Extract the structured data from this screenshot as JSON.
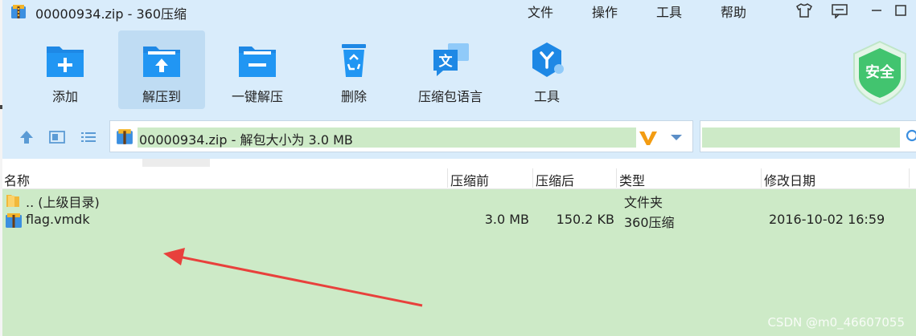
{
  "window": {
    "title": "00000934.zip - 360压缩"
  },
  "menu": [
    "文件",
    "操作",
    "工具",
    "帮助"
  ],
  "toolbar": {
    "items": [
      {
        "label": "添加",
        "icon": "add-folder-icon"
      },
      {
        "label": "解压到",
        "icon": "extract-folder-icon"
      },
      {
        "label": "一键解压",
        "icon": "one-click-extract-icon"
      },
      {
        "label": "删除",
        "icon": "recycle-bin-icon"
      },
      {
        "label": "压缩包语言",
        "icon": "language-icon"
      },
      {
        "label": "工具",
        "icon": "tools-icon"
      }
    ],
    "active_index": 1,
    "security_badge": "安全"
  },
  "address": {
    "path": "00000934.zip - 解包大小为 3.0 MB"
  },
  "columns": [
    "名称",
    "压缩前",
    "压缩后",
    "类型",
    "修改日期"
  ],
  "rows": [
    {
      "name": ".. (上级目录)",
      "before": "",
      "after": "",
      "type": "文件夹",
      "date": "",
      "icon": "folder-icon"
    },
    {
      "name": "flag.vmdk",
      "before": "3.0 MB",
      "after": "150.2 KB",
      "type": "360压缩",
      "date": "2016-10-02 16:59",
      "icon": "archive-file-icon"
    }
  ],
  "watermark": "CSDN @m0_46607055",
  "colors": {
    "accent_blue": "#1e88e5",
    "selection_green": "#cdeac7",
    "arrow_red": "#e8413c",
    "shield_green": "#3ec46d"
  }
}
